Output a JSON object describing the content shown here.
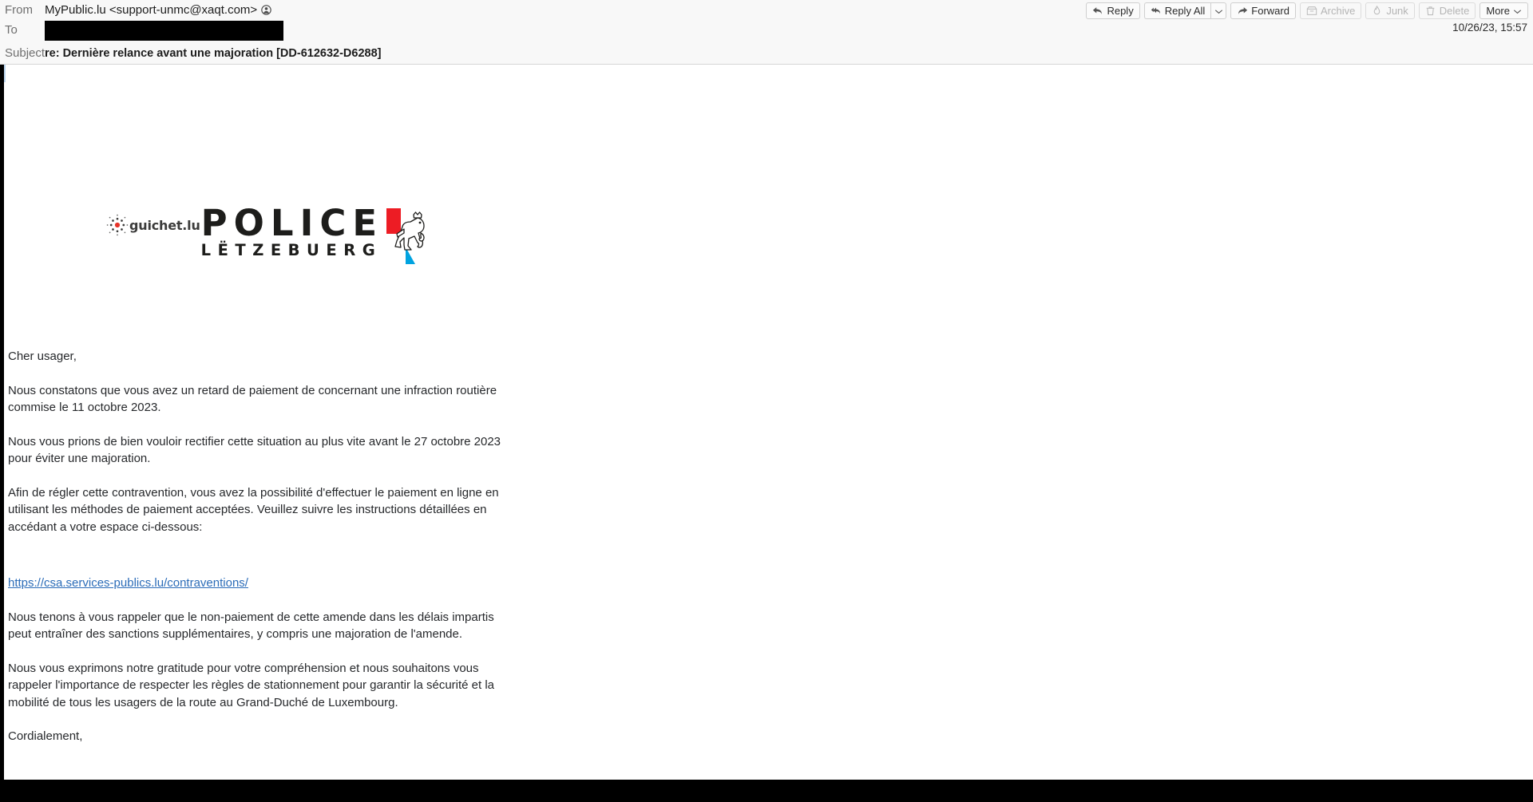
{
  "header": {
    "from_label": "From",
    "from_value": "MyPublic.lu <support-unmc@xaqt.com>",
    "from_icon": "contact-avatar-icon",
    "to_label": "To",
    "to_value": "",
    "subject_label": "Subject",
    "subject_value": "re: Dernière relance avant une majoration [DD-612632-D6288]",
    "timestamp": "10/26/23, 15:57"
  },
  "toolbar": {
    "reply": {
      "label": "Reply",
      "icon": "reply-arrow-icon",
      "disabled": false
    },
    "reply_all": {
      "label": "Reply All",
      "icon": "reply-all-arrow-icon",
      "disabled": false
    },
    "reply_all_arrow": "chevron-down-icon",
    "forward": {
      "label": "Forward",
      "icon": "forward-arrow-icon",
      "disabled": false
    },
    "archive": {
      "label": "Archive",
      "icon": "archive-box-icon",
      "disabled": true
    },
    "junk": {
      "label": "Junk",
      "icon": "junk-flame-icon",
      "disabled": true
    },
    "delete": {
      "label": "Delete",
      "icon": "trash-icon",
      "disabled": true
    },
    "more": {
      "label": "More",
      "icon": "chevron-down-icon",
      "disabled": false
    }
  },
  "logo": {
    "guichet_text": "guichet.lu",
    "guichet_dots_icon": "guichet-dot-cluster-icon",
    "police_text": "POLICE",
    "letzebuerg_text": "LËTZEBUERG",
    "lion_icon": "luxembourg-lion-emblem-icon",
    "colors": {
      "guichet_red": "#e63329",
      "police_black": "#1d1d1b",
      "shield_red": "#ed1c24",
      "shield_blue": "#00a3e0"
    }
  },
  "body": {
    "greeting": "Cher usager,",
    "paragraph_1": "Nous constatons que vous avez un retard de paiement de concernant une infraction routière commise le 11 octobre 2023.",
    "paragraph_2": "Nous vous prions de bien vouloir rectifier cette situation au plus vite avant le 27 octobre 2023 pour éviter une majoration.",
    "paragraph_3": "Afin de régler cette contravention, vous avez la possibilité d'effectuer le paiement en ligne en utilisant les méthodes de paiement acceptées. Veuillez suivre les instructions détaillées en accédant a votre espace ci-dessous:",
    "link_text": "https://csa.services-publics.lu/contraventions/",
    "paragraph_4": "Nous tenons à vous rappeler que le non-paiement de cette amende dans les délais impartis peut entraîner des sanctions supplémentaires, y compris une majoration de l'amende.",
    "paragraph_5": "Nous vous exprimons notre gratitude pour votre compréhension et nous souhaitons vous rappeler l'importance de respecter les règles de stationnement pour garantir la sécurité et la mobilité de tous les usagers de la route au Grand-Duché de Luxembourg.",
    "closing": "Cordialement,"
  }
}
